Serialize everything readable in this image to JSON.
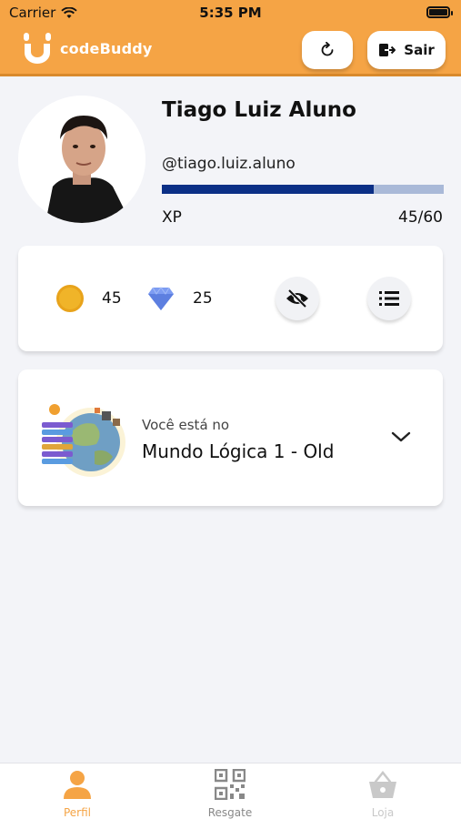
{
  "status": {
    "carrier": "Carrier",
    "time": "5:35 PM"
  },
  "header": {
    "logo_text": "codeBuddy",
    "exit_label": "Sair",
    "accent": "#f5a445"
  },
  "profile": {
    "name": "Tiago Luiz Aluno",
    "handle": "@tiago.luiz.aluno",
    "xp_label": "XP",
    "xp_text": "45/60",
    "xp_current": 45,
    "xp_max": 60,
    "xp_bar_color": "#0b2f86"
  },
  "stats": {
    "coins": "45",
    "gems": "25",
    "coin_icon": "coin-icon",
    "gem_icon": "diamond-icon",
    "hide_icon": "eye-off-icon",
    "list_icon": "list-icon"
  },
  "world": {
    "subtitle": "Você está no",
    "title": "Mundo Lógica 1 - Old"
  },
  "tabs": [
    {
      "label": "Perfil",
      "icon": "person-icon",
      "active": true
    },
    {
      "label": "Resgate",
      "icon": "qr-code-icon",
      "active": false
    },
    {
      "label": "Loja",
      "icon": "basket-icon",
      "active": false
    }
  ]
}
